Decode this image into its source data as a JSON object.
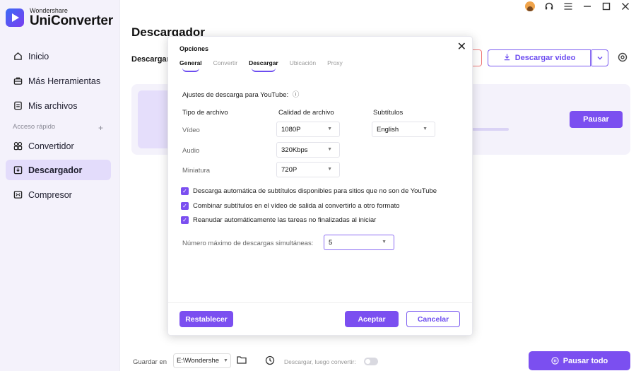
{
  "app": {
    "brand_sub": "Wondershare",
    "brand_main": "UniConverter"
  },
  "sidebar": {
    "items": [
      {
        "label": "Inicio",
        "icon": "home-icon"
      },
      {
        "label": "Más Herramientas",
        "icon": "toolbox-icon"
      },
      {
        "label": "Mis archivos",
        "icon": "files-icon"
      },
      {
        "label": "Convertidor",
        "icon": "convert-icon"
      },
      {
        "label": "Descargador",
        "icon": "download-icon",
        "active": true
      },
      {
        "label": "Compresor",
        "icon": "compress-icon"
      }
    ],
    "quick_access": "Acceso rápido",
    "quick_plus": "+"
  },
  "main": {
    "title": "Descargador",
    "subtab": "Descargando",
    "download_video_label": "Descargar video",
    "pause_label": "Pausar"
  },
  "bottom": {
    "save_label": "Guardar en",
    "save_path": "E:\\Wondershe",
    "dl_then_convert": "Descargar, luego convertir:",
    "pause_all": "Pausar todo"
  },
  "modal": {
    "title": "Opciones",
    "close": "✕",
    "tabs": [
      "General",
      "Convertir",
      "Descargar",
      "Ubicación",
      "Proxy"
    ],
    "active_tab": "Descargar",
    "youtube_label": "Ajustes de descarga para YouTube:",
    "info_icon": "ⓘ",
    "col_type": "Tipo de archivo",
    "col_quality": "Calidad de archivo",
    "col_subs": "Subtítulos",
    "rows": [
      {
        "label": "Vídeo",
        "quality": "1080P",
        "subtitle": "English"
      },
      {
        "label": "Audio",
        "quality": "320Kbps"
      },
      {
        "label": "Miniatura",
        "quality": "720P"
      }
    ],
    "checks": [
      "Descarga automática de subtítulos disponibles para sitios que no son de YouTube",
      "Combinar subtítulos en el vídeo de salida al convertirlo a otro formato",
      "Reanudar automáticamente las tareas no finalizadas al iniciar"
    ],
    "max_label": "Número máximo de descargas simultáneas:",
    "max_value": "5",
    "reset": "Restablecer",
    "accept": "Aceptar",
    "cancel": "Cancelar"
  },
  "colors": {
    "accent": "#7b4ff0",
    "active_nav": "#e3dcfb",
    "sidebar_bg": "#f4f2fb"
  }
}
